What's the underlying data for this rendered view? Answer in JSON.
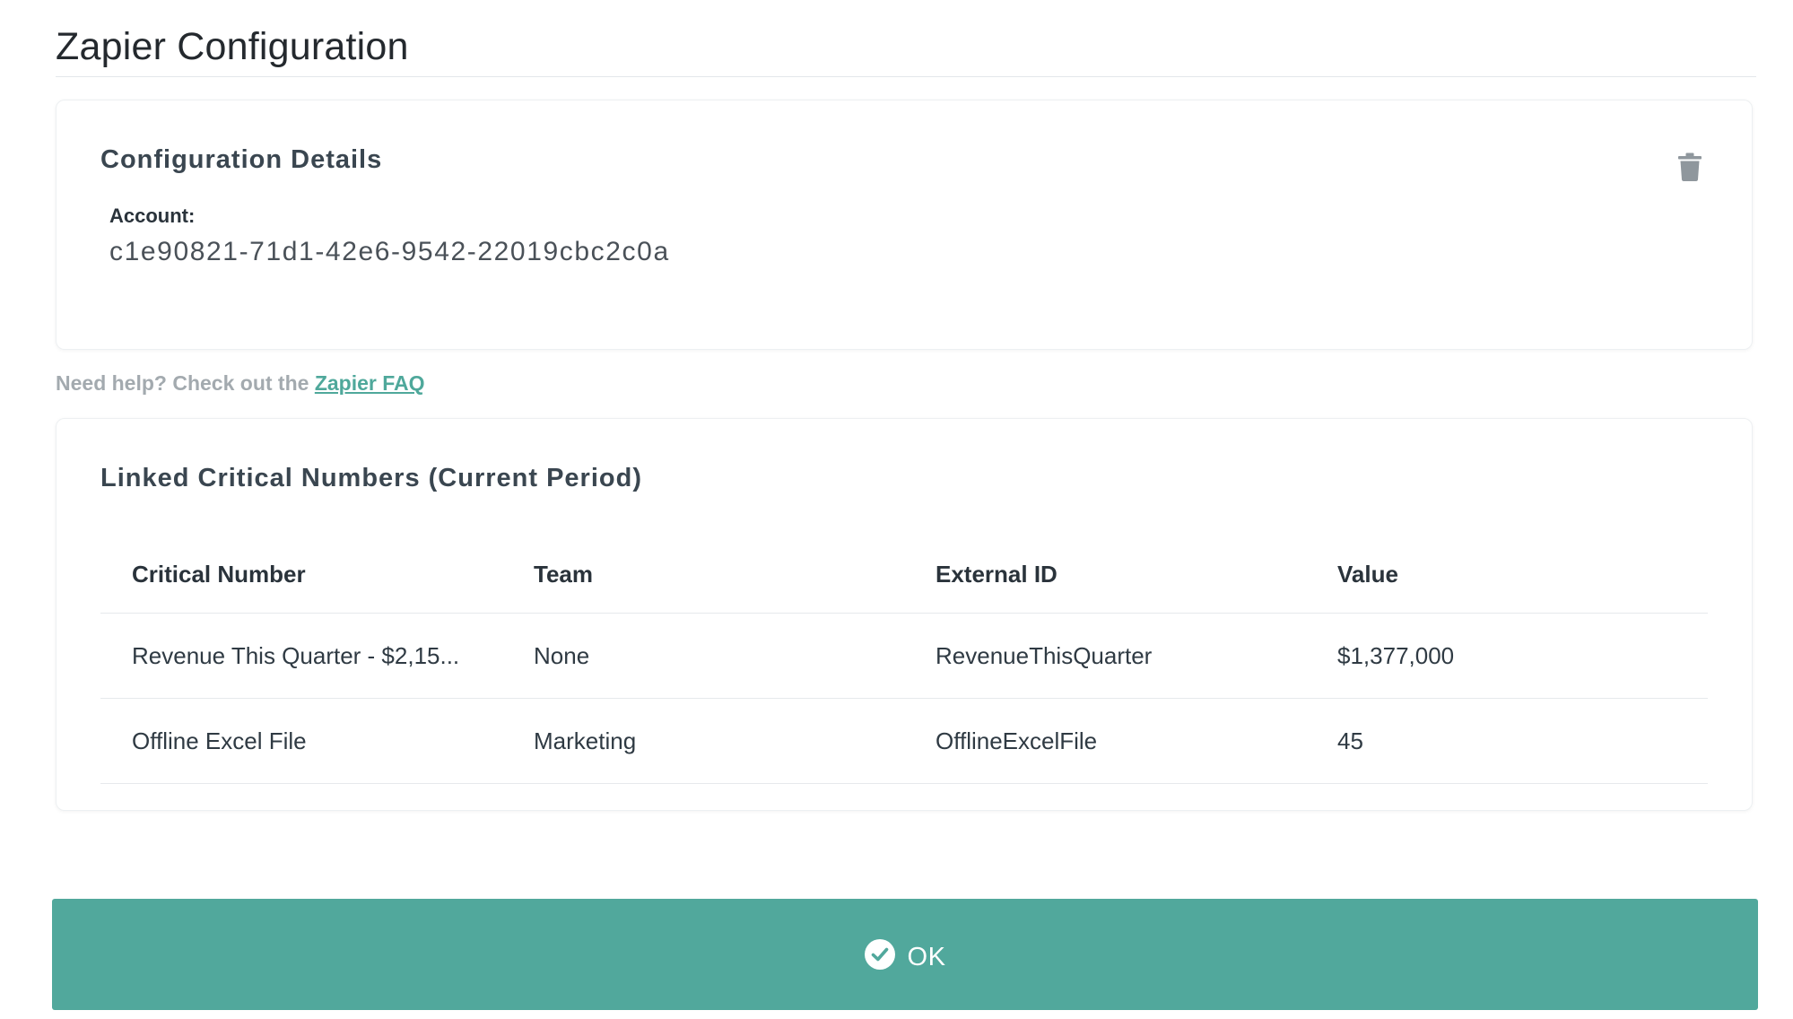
{
  "header": {
    "title": "Zapier Configuration"
  },
  "details_card": {
    "title": "Configuration Details",
    "account_label": "Account:",
    "account_value": "c1e90821-71d1-42e6-9542-22019cbc2c0a",
    "delete_icon": "trash-icon"
  },
  "help": {
    "text": "Need help? Check out the ",
    "link_label": "Zapier FAQ"
  },
  "numbers_card": {
    "title": "Linked Critical Numbers (Current Period)",
    "columns": [
      "Critical Number",
      "Team",
      "External ID",
      "Value"
    ],
    "rows": [
      [
        "Revenue This Quarter - $2,15...",
        "None",
        "RevenueThisQuarter",
        "$1,377,000"
      ],
      [
        "Offline Excel File",
        "Marketing",
        "OfflineExcelFile",
        "45"
      ]
    ]
  },
  "footer": {
    "ok_label": "OK",
    "ok_icon": "check-circle-icon"
  },
  "colors": {
    "accent": "#51a89c",
    "link": "#4fa89b",
    "muted_text": "#a3aaaf"
  }
}
